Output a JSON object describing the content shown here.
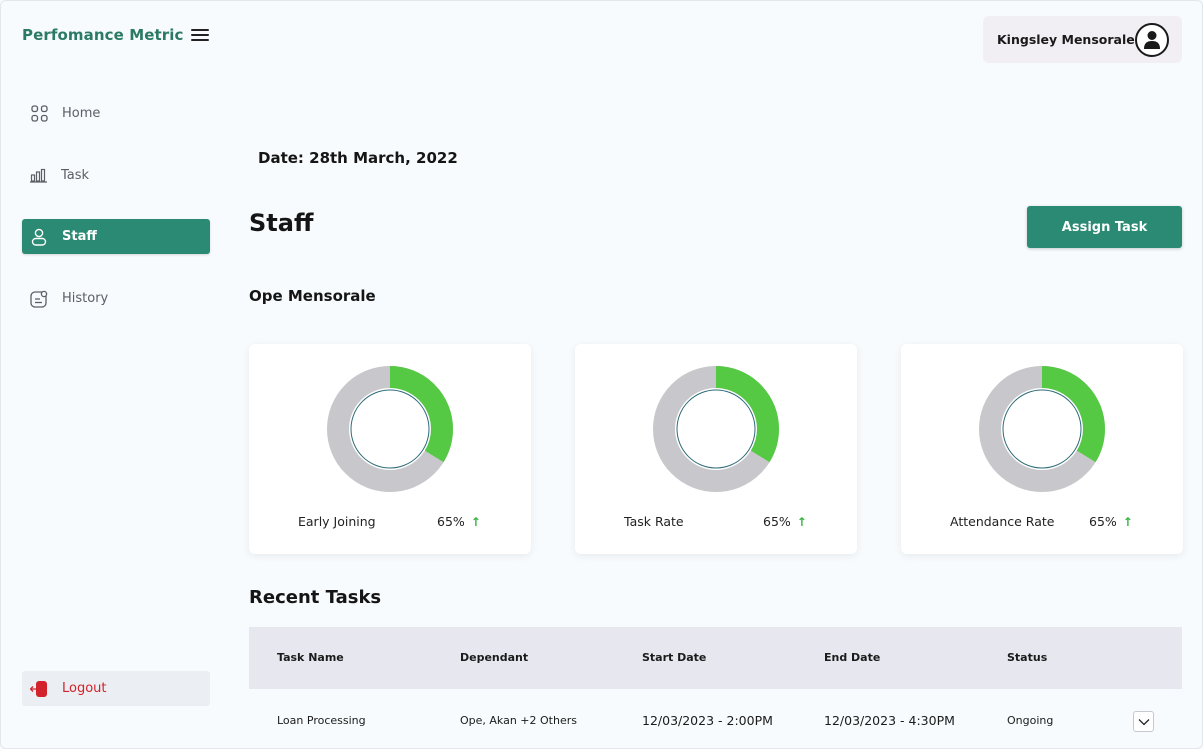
{
  "app": {
    "brand": "Perfomance Metric"
  },
  "sidebar": {
    "items": [
      {
        "label": "Home",
        "icon": "grid-icon"
      },
      {
        "label": "Task",
        "icon": "bar-chart-icon"
      },
      {
        "label": "Staff",
        "icon": "user-icon",
        "active": true
      },
      {
        "label": "History",
        "icon": "history-icon"
      }
    ],
    "logout_label": "Logout"
  },
  "header": {
    "user_name": "Kingsley Mensorale"
  },
  "main": {
    "date": "Date: 28th March, 2022",
    "title": "Staff",
    "assign_button": "Assign Task",
    "staff_name": "Ope Mensorale",
    "metrics": [
      {
        "label": "Early Joining",
        "value": "65%",
        "progress": 0.65
      },
      {
        "label": "Task Rate",
        "value": "65%",
        "progress": 0.65
      },
      {
        "label": "Attendance Rate",
        "value": "65%",
        "progress": 0.65
      }
    ],
    "recent_title": "Recent Tasks",
    "table": {
      "headers": [
        "Task Name",
        "Dependant",
        "Start Date",
        "End Date",
        "Status"
      ],
      "rows": [
        [
          "Loan Processing",
          "Ope, Akan +2 Others",
          "12/03/2023 - 2:00PM",
          "12/03/2023 - 4:30PM",
          "Ongoing"
        ]
      ]
    }
  },
  "colors": {
    "brand": "#2b7a63",
    "accent": "#2b8a73",
    "progress": "#55c844",
    "track": "#c8c8cc",
    "logout": "#d2222b",
    "up_arrow": "#35b544"
  }
}
